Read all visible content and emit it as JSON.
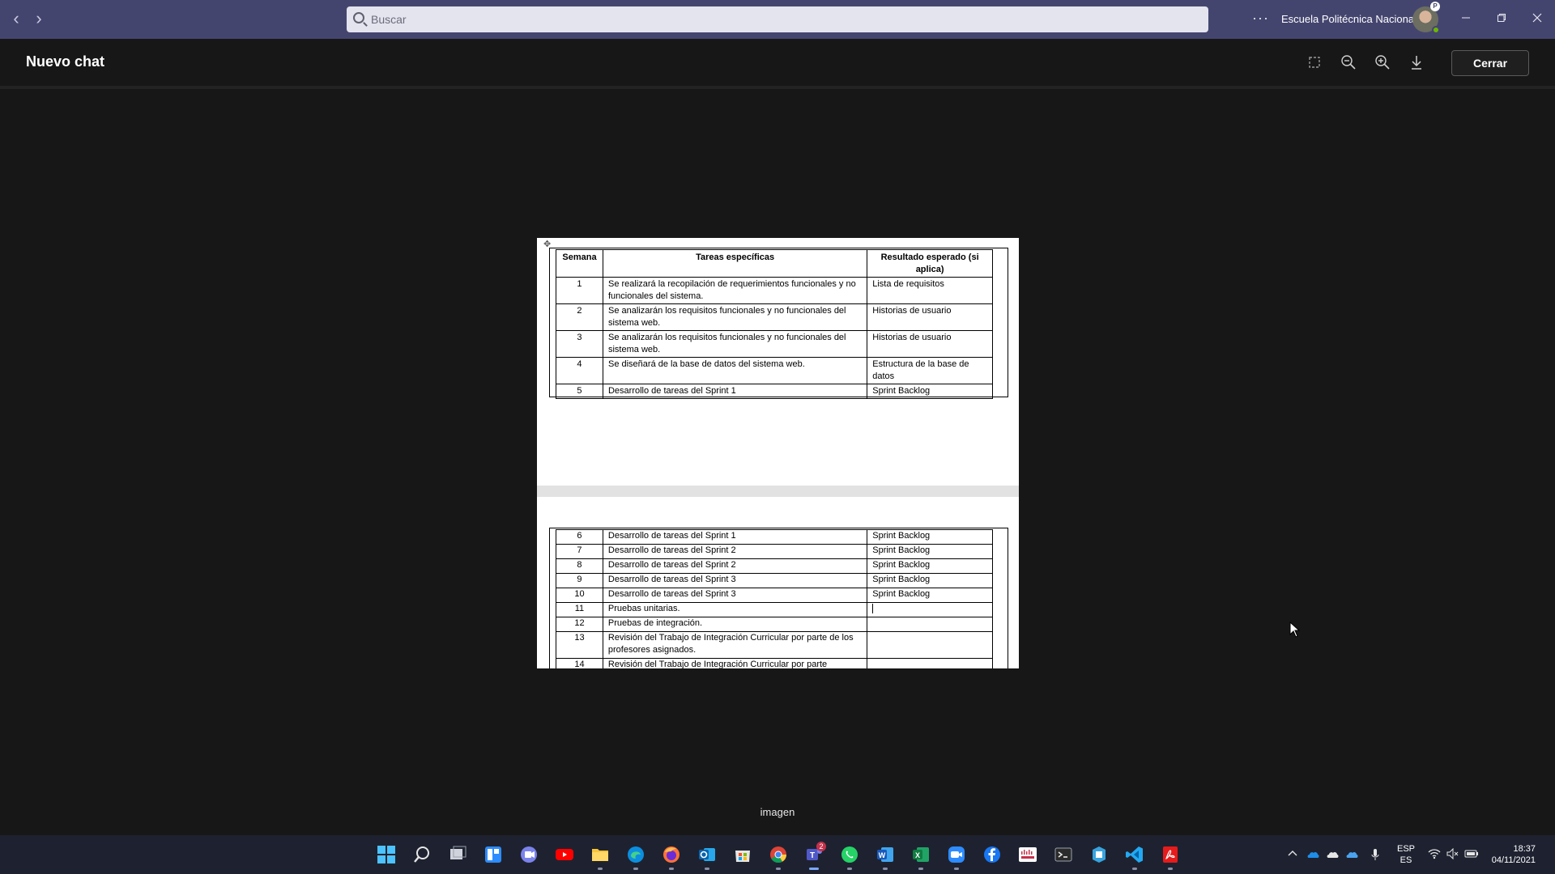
{
  "titlebar": {
    "search_placeholder": "Buscar",
    "more_label": "···",
    "organization": "Escuela Politécnica Nacional",
    "avatar_badge": "P"
  },
  "viewer": {
    "title": "Nuevo chat",
    "close_label": "Cerrar",
    "caption": "imagen",
    "tools": [
      "fit-to-screen-icon",
      "zoom-out-icon",
      "zoom-in-icon",
      "download-icon"
    ]
  },
  "document": {
    "headers": [
      "Semana",
      "Tareas específicas",
      "Resultado esperado (si aplica)"
    ],
    "rows_page1": [
      {
        "week": "1",
        "task": "Se realizará la recopilación de requerimientos funcionales y no funcionales del sistema.",
        "result": "Lista de requisitos"
      },
      {
        "week": "2",
        "task": "Se analizarán los requisitos funcionales y no funcionales del sistema web.",
        "result": "Historias de usuario"
      },
      {
        "week": "3",
        "task": "Se analizarán los requisitos funcionales y no funcionales del sistema web.",
        "result": "Historias de usuario"
      },
      {
        "week": "4",
        "task": "Se diseñará de la base de datos del sistema web.",
        "result": "Estructura de la base de datos"
      },
      {
        "week": "5",
        "task": "Desarrollo de tareas del Sprint 1",
        "result": "Sprint Backlog"
      }
    ],
    "rows_page2": [
      {
        "week": "6",
        "task": "Desarrollo de tareas del Sprint 1",
        "result": "Sprint Backlog"
      },
      {
        "week": "7",
        "task": "Desarrollo de tareas del Sprint 2",
        "result": "Sprint Backlog"
      },
      {
        "week": "8",
        "task": "Desarrollo de tareas del Sprint 2",
        "result": "Sprint Backlog"
      },
      {
        "week": "9",
        "task": "Desarrollo de tareas del Sprint 3",
        "result": "Sprint Backlog"
      },
      {
        "week": "10",
        "task": "Desarrollo de tareas del Sprint 3",
        "result": "Sprint Backlog"
      },
      {
        "week": "11",
        "task": "Pruebas unitarias.",
        "result": ""
      },
      {
        "week": "12",
        "task": "Pruebas de integración.",
        "result": ""
      },
      {
        "week": "13",
        "task": "Revisión del Trabajo de Integración Curricular por parte de los profesores asignados.",
        "result": ""
      },
      {
        "week": "14",
        "task": "Revisión del Trabajo de Integración Curricular por parte",
        "result": ""
      }
    ]
  },
  "taskbar": {
    "teams_badge": "2",
    "lang_top": "ESP",
    "lang_bottom": "ES",
    "time": "18:37",
    "date": "04/11/2021",
    "apps": [
      "start-icon",
      "search-icon",
      "task-view-icon",
      "widgets-icon",
      "teams-chat-icon",
      "youtube-icon",
      "file-explorer-icon",
      "edge-icon",
      "firefox-icon",
      "outlook-icon",
      "store-icon",
      "chrome-icon",
      "teams-icon",
      "whatsapp-icon",
      "word-icon",
      "excel-icon",
      "zoom-icon",
      "facebook-icon",
      "cisco-icon",
      "terminal-icon",
      "azure-data-studio-icon",
      "vscode-icon",
      "acrobat-icon"
    ]
  }
}
